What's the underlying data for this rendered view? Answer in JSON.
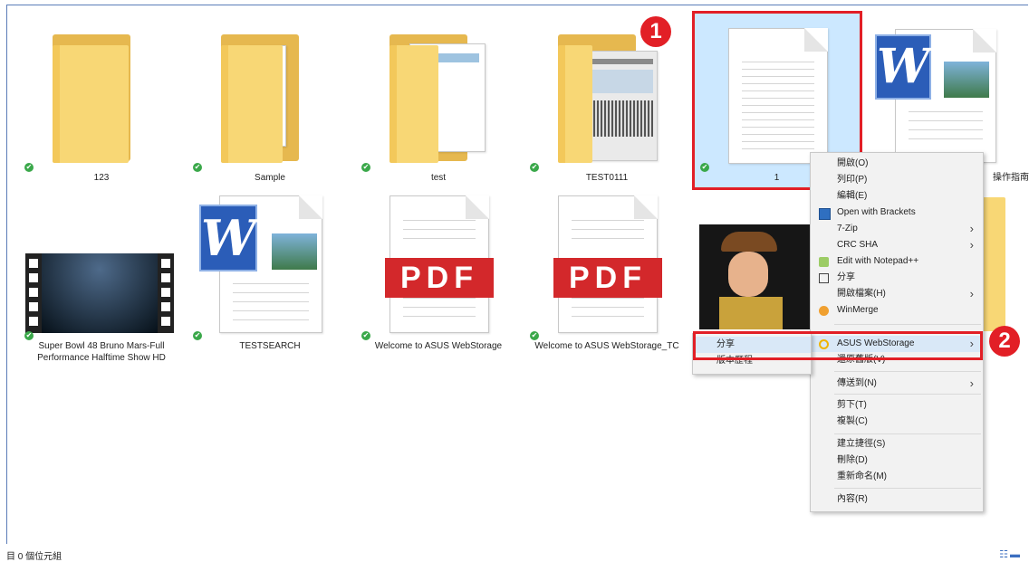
{
  "files": [
    {
      "label": "123",
      "kind": "folder"
    },
    {
      "label": "Sample",
      "kind": "folder"
    },
    {
      "label": "test",
      "kind": "folder"
    },
    {
      "label": "TEST0111",
      "kind": "folder"
    },
    {
      "label": "1",
      "kind": "text-document",
      "selected": true
    },
    {
      "label": "操作指南",
      "kind": "word-document"
    },
    {
      "label": "Super Bowl 48 Bruno Mars-Full Performance Halftime Show HD",
      "kind": "video"
    },
    {
      "label": "TESTSEARCH",
      "kind": "word-document"
    },
    {
      "label": "Welcome to ASUS WebStorage",
      "kind": "pdf"
    },
    {
      "label": "Welcome to ASUS WebStorage_TC",
      "kind": "pdf"
    },
    {
      "label": "",
      "kind": "image"
    },
    {
      "label": "",
      "kind": "folder"
    }
  ],
  "pdf_text": "PDF",
  "word_letter": "W",
  "sync_glyph": "✔",
  "context_menu": {
    "items": [
      {
        "label": "開啟(O)"
      },
      {
        "label": "列印(P)"
      },
      {
        "label": "編輯(E)"
      },
      {
        "label": "Open with Brackets",
        "icon": "brackets-icon"
      },
      {
        "label": "7-Zip",
        "submenu": true
      },
      {
        "label": "CRC SHA",
        "submenu": true
      },
      {
        "label": "Edit with Notepad++",
        "icon": "notepadpp-icon"
      },
      {
        "label": "分享",
        "icon": "share-icon"
      },
      {
        "label": "開啟檔案(H)",
        "submenu": true
      },
      {
        "label": "WinMerge",
        "icon": "winmerge-icon"
      },
      {
        "label": "ASUS WebStorage",
        "submenu": true,
        "icon": "asus-webstorage-icon",
        "highlighted": true
      },
      {
        "label": "還原舊版(V)"
      },
      {
        "label": "傳送到(N)",
        "submenu": true
      },
      {
        "label": "剪下(T)"
      },
      {
        "label": "複製(C)"
      },
      {
        "label": "建立捷徑(S)"
      },
      {
        "label": "刪除(D)"
      },
      {
        "label": "重新命名(M)"
      },
      {
        "label": "內容(R)"
      }
    ]
  },
  "submenu": {
    "items": [
      {
        "label": "分享",
        "highlighted": true
      },
      {
        "label": "版本歷程"
      }
    ]
  },
  "annotations": {
    "marker1": "1",
    "marker2": "2",
    "color": "#e21f26"
  },
  "status_bar": {
    "text": "目 0 個位元組"
  },
  "colors": {
    "selection": "#cce8ff",
    "folder": "#f8d775",
    "pdf_red": "#d3282b",
    "word_blue": "#2b5db8",
    "menu_highlight": "#d9e8f7"
  }
}
